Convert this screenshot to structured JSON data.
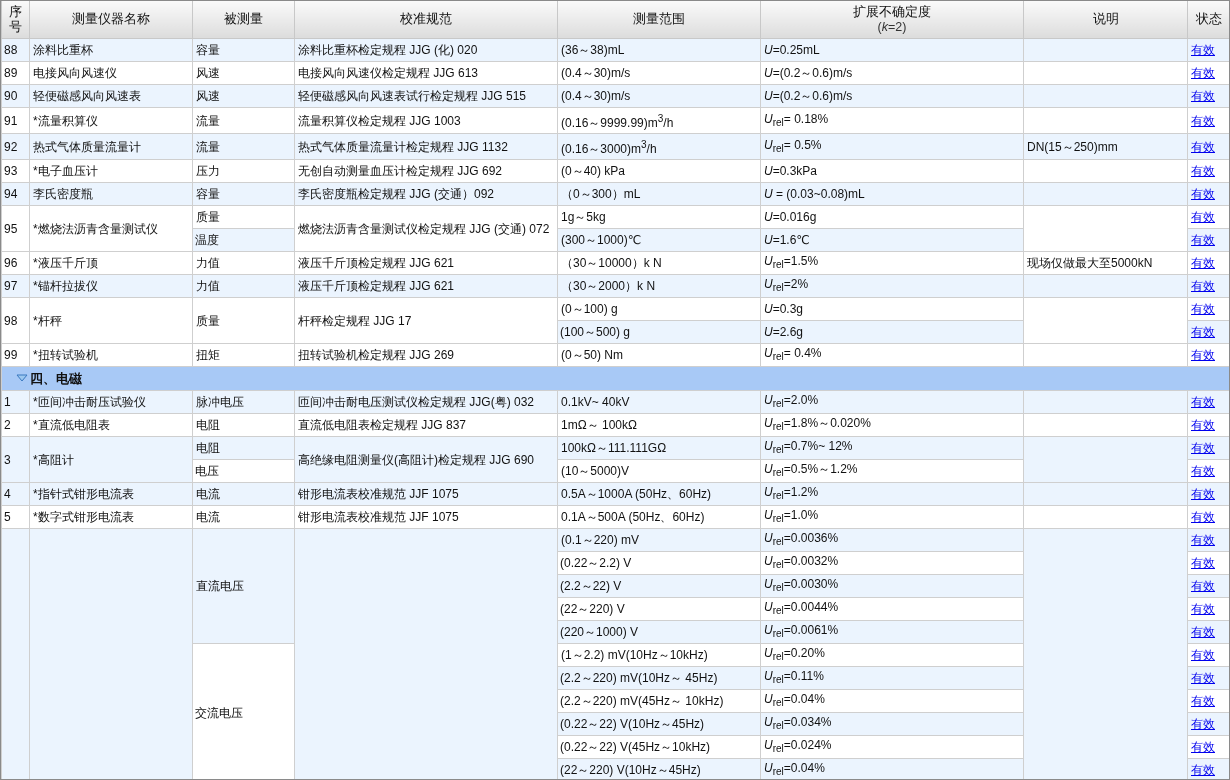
{
  "table": {
    "columns": [
      {
        "title": "序号"
      },
      {
        "title": "测量仪器名称"
      },
      {
        "title": "被测量"
      },
      {
        "title": "校准规范"
      },
      {
        "title": "测量范围"
      },
      {
        "title": "扩展不确定度",
        "subtitle": "(*k*=2)"
      },
      {
        "title": "说明"
      },
      {
        "title": "状态"
      }
    ],
    "rows": [
      {
        "kind": "instrument",
        "no": "88",
        "name": "涂料比重杯",
        "spec": "涂料比重杯检定规程 JJG (化) 020",
        "quantities": [
          {
            "name": "容量",
            "ranges": [
              {
                "range": "(36～38)mL",
                "uncertainty": "*U*=0.25mL",
                "status": "有效"
              }
            ]
          }
        ]
      },
      {
        "kind": "instrument",
        "no": "89",
        "name": "电接风向风速仪",
        "spec": "电接风向风速仪检定规程 JJG 613",
        "quantities": [
          {
            "name": "风速",
            "ranges": [
              {
                "range": "(0.4～30)m/s",
                "uncertainty": "*U*=(0.2～0.6)m/s",
                "status": "有效"
              }
            ]
          }
        ]
      },
      {
        "kind": "instrument",
        "no": "90",
        "name": "轻便磁感风向风速表",
        "spec": "轻便磁感风向风速表试行检定规程 JJG 515",
        "quantities": [
          {
            "name": "风速",
            "ranges": [
              {
                "range": "(0.4～30)m/s",
                "uncertainty": "*U*=(0.2～0.6)m/s",
                "status": "有效"
              }
            ]
          }
        ]
      },
      {
        "kind": "instrument",
        "no": "91",
        "name": "*流量积算仪",
        "spec": "流量积算仪检定规程 JJG 1003",
        "quantities": [
          {
            "name": "流量",
            "ranges": [
              {
                "range": "(0.16～9999.99)m$^{3}$/h",
                "uncertainty": "*U*$_{rel}$= 0.18%",
                "status": "有效"
              }
            ]
          }
        ]
      },
      {
        "kind": "instrument",
        "no": "92",
        "name": "热式气体质量流量计",
        "spec": "热式气体质量流量计检定规程 JJG 1132",
        "note": "DN(15～250)mm",
        "quantities": [
          {
            "name": "流量",
            "ranges": [
              {
                "range": "(0.16～3000)m$^{3}$/h",
                "uncertainty": "*U*$_{rel}$= 0.5%",
                "status": "有效"
              }
            ]
          }
        ]
      },
      {
        "kind": "instrument",
        "no": "93",
        "name": "*电子血压计",
        "spec": "无创自动测量血压计检定规程 JJG 692",
        "quantities": [
          {
            "name": "压力",
            "ranges": [
              {
                "range": "(0～40) kPa",
                "uncertainty": "*U*=0.3kPa",
                "status": "有效"
              }
            ]
          }
        ]
      },
      {
        "kind": "instrument",
        "no": "94",
        "name": "李氏密度瓶",
        "spec": "李氏密度瓶检定规程 JJG (交通）092",
        "quantities": [
          {
            "name": "容量",
            "ranges": [
              {
                "range": "（0～300）mL",
                "uncertainty": "*U* = (0.03~0.08)mL",
                "status": "有效"
              }
            ]
          }
        ]
      },
      {
        "kind": "instrument",
        "no": "95",
        "name": "*燃烧法沥青含量测试仪",
        "spec": "燃烧法沥青含量测试仪检定规程 JJG (交通) 072",
        "quantities": [
          {
            "name": "质量",
            "ranges": [
              {
                "range": "1g～5kg",
                "uncertainty": "*U*=0.016g",
                "status": "有效"
              }
            ]
          },
          {
            "name": "温度",
            "ranges": [
              {
                "range": "(300～1000)℃",
                "uncertainty": "*U*=1.6℃",
                "status": "有效"
              }
            ]
          }
        ]
      },
      {
        "kind": "instrument",
        "no": "96",
        "name": "*液压千斤顶",
        "spec": "液压千斤顶检定规程 JJG 621",
        "note": "现场仅做最大至5000kN",
        "quantities": [
          {
            "name": "力值",
            "ranges": [
              {
                "range": "（30～10000）k N",
                "uncertainty": "*U*$_{rel}$=1.5%",
                "status": "有效"
              }
            ]
          }
        ]
      },
      {
        "kind": "instrument",
        "no": "97",
        "name": "*锚杆拉拔仪",
        "spec": "液压千斤顶检定规程 JJG 621",
        "quantities": [
          {
            "name": "力值",
            "ranges": [
              {
                "range": "（30～2000）k N",
                "uncertainty": "*U*$_{rel}$=2%",
                "status": "有效"
              }
            ]
          }
        ]
      },
      {
        "kind": "instrument",
        "no": "98",
        "name": "*杆秤",
        "spec": "杆秤检定规程 JJG 17",
        "quantities": [
          {
            "name": "质量",
            "ranges": [
              {
                "range": "(0～100) g",
                "uncertainty": "*U*=0.3g",
                "status": "有效"
              },
              {
                "range": "(100～500) g",
                "uncertainty": "*U*=2.6g",
                "status": "有效"
              }
            ]
          }
        ]
      },
      {
        "kind": "instrument",
        "no": "99",
        "name": "*扭转试验机",
        "spec": "扭转试验机检定规程 JJG 269",
        "quantities": [
          {
            "name": "扭矩",
            "ranges": [
              {
                "range": "(0～50) Nm",
                "uncertainty": "*U*$_{rel}$= 0.4%",
                "status": "有效"
              }
            ]
          }
        ]
      },
      {
        "kind": "section",
        "title": "四、电磁",
        "expanded": true
      },
      {
        "kind": "instrument",
        "no": "1",
        "name": "*匝间冲击耐压试验仪",
        "spec": "匝间冲击耐电压测试仪检定规程 JJG(粤) 032",
        "quantities": [
          {
            "name": "脉冲电压",
            "ranges": [
              {
                "range": "0.1kV~ 40kV",
                "uncertainty": "*U*$_{rel}$=2.0%",
                "status": "有效"
              }
            ]
          }
        ]
      },
      {
        "kind": "instrument",
        "no": "2",
        "name": "*直流低电阻表",
        "spec": "直流低电阻表检定规程 JJG 837",
        "quantities": [
          {
            "name": "电阻",
            "ranges": [
              {
                "range": "1mΩ～ 100kΩ",
                "uncertainty": "*U*$_{rel}$=1.8%～0.020%",
                "status": "有效"
              }
            ]
          }
        ]
      },
      {
        "kind": "instrument",
        "no": "3",
        "name": "*高阻计",
        "spec": "高绝缘电阻测量仪(高阻计)检定规程 JJG 690",
        "quantities": [
          {
            "name": "电阻",
            "ranges": [
              {
                "range": "100kΩ～111.111GΩ",
                "uncertainty": "*U*$_{rel}$=0.7%~ 12%",
                "status": "有效"
              }
            ]
          },
          {
            "name": "电压",
            "ranges": [
              {
                "range": "(10～5000)V",
                "uncertainty": "*U*$_{rel}$=0.5%～1.2%",
                "status": "有效"
              }
            ]
          }
        ]
      },
      {
        "kind": "instrument",
        "no": "4",
        "name": "*指针式钳形电流表",
        "spec": "钳形电流表校准规范 JJF 1075",
        "quantities": [
          {
            "name": "电流",
            "ranges": [
              {
                "range": "0.5A～1000A (50Hz、60Hz)",
                "uncertainty": "*U*$_{rel}$=1.2%",
                "status": "有效"
              }
            ]
          }
        ]
      },
      {
        "kind": "instrument",
        "no": "5",
        "name": "*数字式钳形电流表",
        "spec": "钳形电流表校准规范 JJF 1075",
        "quantities": [
          {
            "name": "电流",
            "ranges": [
              {
                "range": "0.1A～500A (50Hz、60Hz)",
                "uncertainty": "*U*$_{rel}$=1.0%",
                "status": "有效"
              }
            ]
          }
        ]
      },
      {
        "kind": "instrument",
        "quantities": [
          {
            "name": "直流电压",
            "ranges": [
              {
                "range": "(0.1～220) mV",
                "uncertainty": "*U*$_{rel}$=0.0036%",
                "status": "有效"
              },
              {
                "range": "(0.22～2.2) V",
                "uncertainty": "*U*$_{rel}$=0.0032%",
                "status": "有效"
              },
              {
                "range": "(2.2～22) V",
                "uncertainty": "*U*$_{rel}$=0.0030%",
                "status": "有效"
              },
              {
                "range": "(22～220) V",
                "uncertainty": "*U*$_{rel}$=0.0044%",
                "status": "有效"
              },
              {
                "range": "(220～1000) V",
                "uncertainty": "*U*$_{rel}$=0.0061%",
                "status": "有效"
              }
            ]
          },
          {
            "name": "交流电压",
            "ranges": [
              {
                "range": "(1～2.2) mV(10Hz～10kHz)",
                "uncertainty": "*U*$_{rel}$=0.20%",
                "status": "有效"
              },
              {
                "range": "(2.2～220) mV(10Hz～ 45Hz)",
                "uncertainty": "*U*$_{rel}$=0.11%",
                "status": "有效"
              },
              {
                "range": "(2.2～220) mV(45Hz～ 10kHz)",
                "uncertainty": "*U*$_{rel}$=0.04%",
                "status": "有效"
              },
              {
                "range": "(0.22～22) V(10Hz～45Hz)",
                "uncertainty": "*U*$_{rel}$=0.034%",
                "status": "有效"
              },
              {
                "range": "(0.22～22) V(45Hz～10kHz)",
                "uncertainty": "*U*$_{rel}$=0.024%",
                "status": "有效"
              },
              {
                "range": "(22～220) V(10Hz～45Hz)",
                "uncertainty": "*U*$_{rel}$=0.04%",
                "status": "有效"
              }
            ]
          }
        ]
      }
    ]
  }
}
